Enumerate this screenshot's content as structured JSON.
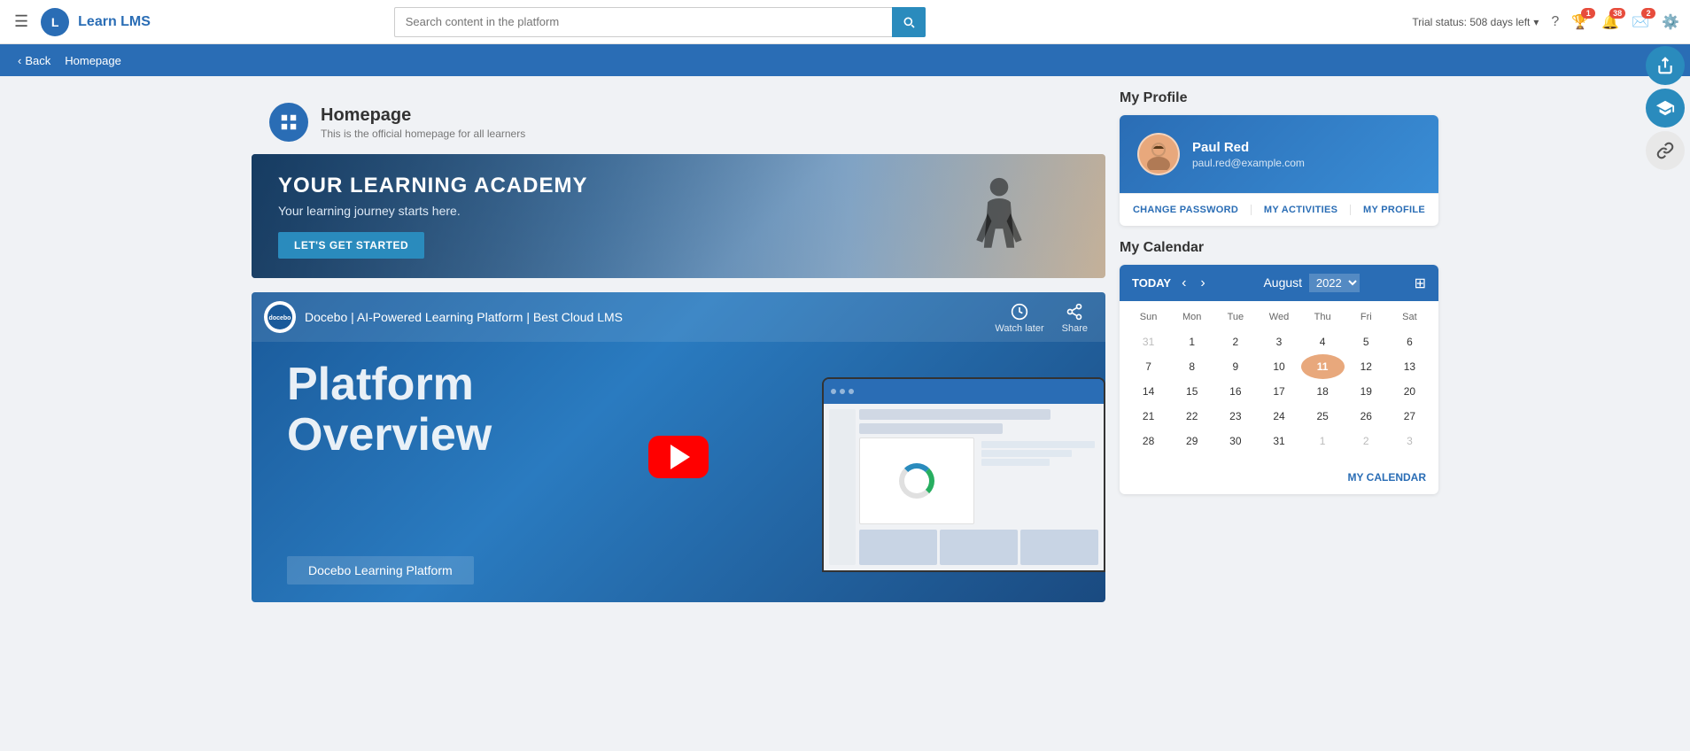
{
  "brand": {
    "logo_text": "L",
    "name": "Learn LMS"
  },
  "search": {
    "placeholder": "Search content in the platform"
  },
  "top_nav": {
    "trial_status": "Trial status: 508 days left",
    "notification_badge": "38",
    "trophy_badge": "1",
    "message_badge": "2"
  },
  "sub_nav": {
    "back_label": "Back",
    "breadcrumb": "Homepage"
  },
  "homepage": {
    "title": "Homepage",
    "subtitle": "This is the official homepage for all learners"
  },
  "banner": {
    "title": "YOUR LEARNING ACADEMY",
    "subtitle": "Your learning journey starts here.",
    "cta": "LET'S GET STARTED"
  },
  "video": {
    "channel": "docebo",
    "title": "Docebo | AI-Powered Learning Platform | Best Cloud LMS",
    "watch_later": "Watch later",
    "share": "Share",
    "platform_line1": "Platform",
    "platform_line2": "Overview",
    "label": "Docebo Learning Platform"
  },
  "profile": {
    "section_title": "My Profile",
    "avatar_icon": "👤",
    "name": "Paul Red",
    "email": "paul.red@example.com",
    "change_password": "CHANGE PASSWORD",
    "my_activities": "MY ACTIVITIES",
    "my_profile": "MY PROFILE"
  },
  "calendar": {
    "section_title": "My Calendar",
    "today": "TODAY",
    "month": "August",
    "year": "2022",
    "weekdays": [
      "Sun",
      "Mon",
      "Tue",
      "Wed",
      "Thu",
      "Fri",
      "Sat"
    ],
    "weeks": [
      [
        {
          "day": "31",
          "other": true
        },
        {
          "day": "1"
        },
        {
          "day": "2"
        },
        {
          "day": "3"
        },
        {
          "day": "4"
        },
        {
          "day": "5"
        },
        {
          "day": "6"
        }
      ],
      [
        {
          "day": "7"
        },
        {
          "day": "8"
        },
        {
          "day": "9"
        },
        {
          "day": "10"
        },
        {
          "day": "11",
          "today": true
        },
        {
          "day": "12"
        },
        {
          "day": "13"
        }
      ],
      [
        {
          "day": "14"
        },
        {
          "day": "15"
        },
        {
          "day": "16"
        },
        {
          "day": "17"
        },
        {
          "day": "18"
        },
        {
          "day": "19"
        },
        {
          "day": "20"
        }
      ],
      [
        {
          "day": "21"
        },
        {
          "day": "22"
        },
        {
          "day": "23"
        },
        {
          "day": "24"
        },
        {
          "day": "25"
        },
        {
          "day": "26"
        },
        {
          "day": "27"
        }
      ],
      [
        {
          "day": "28"
        },
        {
          "day": "29"
        },
        {
          "day": "30"
        },
        {
          "day": "31"
        },
        {
          "day": "1",
          "other": true
        },
        {
          "day": "2",
          "other": true
        },
        {
          "day": "3",
          "other": true
        }
      ]
    ],
    "my_calendar_link": "MY CALENDAR"
  },
  "floating_btns": {
    "share": "↗",
    "graduation": "🎓",
    "link": "🔗"
  }
}
